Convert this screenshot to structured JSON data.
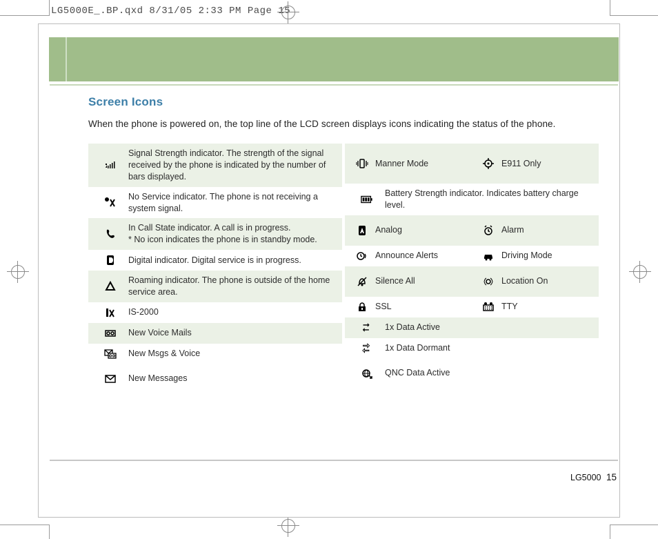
{
  "print_meta": "LG5000E_.BP.qxd  8/31/05  2:33 PM  Page 15",
  "heading": "Screen Icons",
  "intro": "When the phone is powered on, the top line of the LCD screen displays icons indicating the status of the phone.",
  "footer": {
    "model": "LG5000",
    "page": "15"
  },
  "left_col": [
    {
      "desc": "Signal Strength indicator. The strength of the signal received by the phone is indicated by the number of bars displayed."
    },
    {
      "desc": "No Service indicator. The phone is not receiving a system signal."
    },
    {
      "desc": "In Call State indicator. A call is in progress.\n* No icon indicates the phone is in standby mode."
    },
    {
      "desc": "Digital indicator. Digital service is in progress."
    },
    {
      "desc": "Roaming indicator. The phone is outside of the home service area."
    },
    {
      "desc": "IS-2000"
    },
    {
      "desc": "New Voice Mails"
    },
    {
      "desc": "New Msgs & Voice"
    },
    {
      "desc": "New Messages"
    }
  ],
  "right_col": [
    {
      "type": "split",
      "a_label": "Manner Mode",
      "b_label": "E911 Only"
    },
    {
      "type": "full",
      "desc": "Battery Strength indicator. Indicates battery charge level."
    },
    {
      "type": "split",
      "a_label": "Analog",
      "b_label": "Alarm"
    },
    {
      "type": "split",
      "a_label": "Announce Alerts",
      "b_label": "Driving Mode"
    },
    {
      "type": "split",
      "a_label": "Silence All",
      "b_label": "Location On"
    },
    {
      "type": "split",
      "a_label": "SSL",
      "b_label": "TTY"
    },
    {
      "type": "single",
      "label": "1x Data Active"
    },
    {
      "type": "single",
      "label": "1x Data Dormant"
    },
    {
      "type": "single",
      "label": "QNC Data Active"
    }
  ]
}
